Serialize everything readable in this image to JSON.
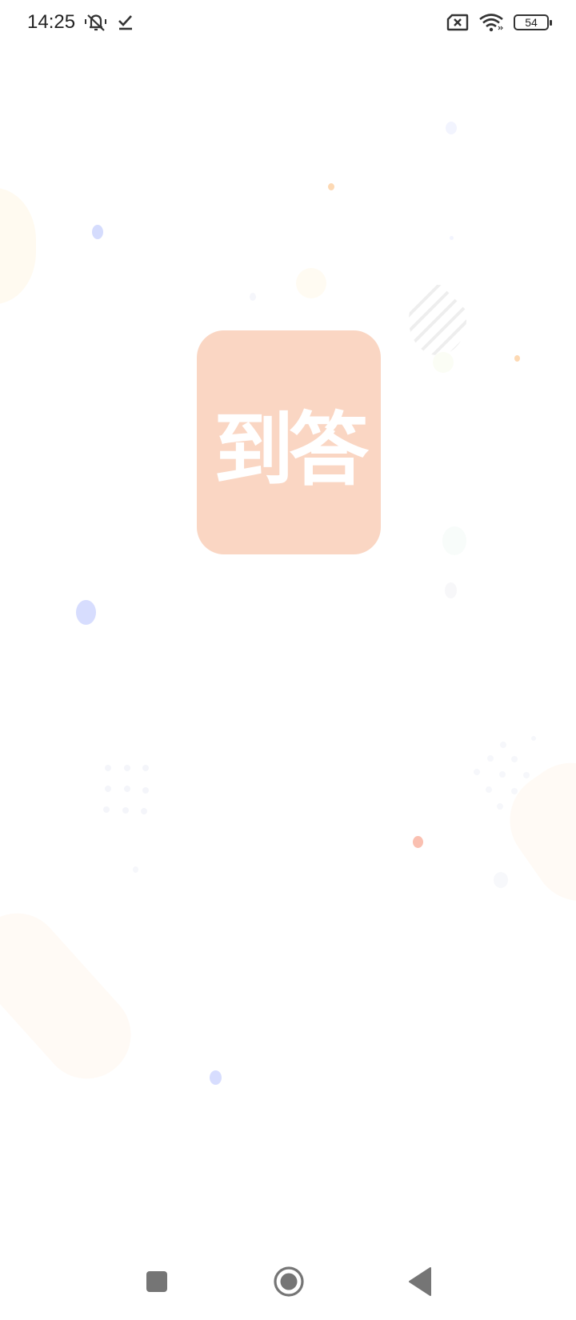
{
  "status_bar": {
    "time": "14:25",
    "left_icons": [
      "notifications-muted-icon",
      "check-icon"
    ],
    "right_icons": [
      "sim-off-icon",
      "wifi-icon",
      "battery-icon"
    ],
    "battery_level": "54"
  },
  "splash": {
    "logo_text": "到答",
    "logo_color": "#fad6c3"
  },
  "nav_bar": {
    "buttons": [
      "recents-button",
      "home-button",
      "back-button"
    ]
  }
}
